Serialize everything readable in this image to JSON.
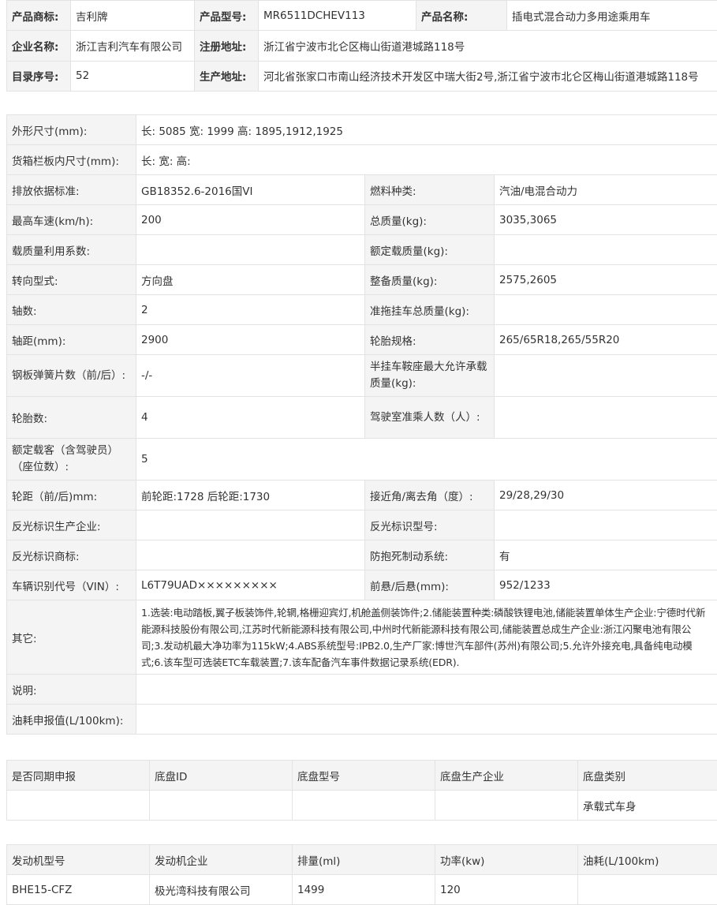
{
  "header": {
    "rows": [
      [
        {
          "label": "产品商标:",
          "value": "吉利牌"
        },
        {
          "label": "产品型号:",
          "value": "MR6511DCHEV113"
        },
        {
          "label": "产品名称:",
          "value": "插电式混合动力多用途乘用车"
        }
      ],
      [
        {
          "label": "企业名称:",
          "value": "浙江吉利汽车有限公司"
        },
        {
          "label": "注册地址:",
          "value": "浙江省宁波市北仑区梅山街道港城路118号"
        }
      ],
      [
        {
          "label": "目录序号:",
          "value": "52"
        },
        {
          "label": "生产地址:",
          "value": "河北省张家口市南山经济技术开发区中瑞大街2号,浙江省宁波市北仑区梅山街道港城路118号"
        }
      ]
    ]
  },
  "params": {
    "dimensions": {
      "label": "外形尺寸(mm):",
      "value": "长:  5085 宽:  1999 高:  1895,1912,1925"
    },
    "cargo_box": {
      "label": "货箱栏板内尺寸(mm):",
      "value": "长:   宽:   高:"
    },
    "pairs": [
      {
        "l1": "排放依据标准:",
        "v1": "GB18352.6-2016国VI",
        "l2": "燃料种类:",
        "v2": "汽油/电混合动力"
      },
      {
        "l1": "最高车速(km/h):",
        "v1": "200",
        "l2": "总质量(kg):",
        "v2": "3035,3065"
      },
      {
        "l1": "载质量利用系数:",
        "v1": "",
        "l2": "额定载质量(kg):",
        "v2": ""
      },
      {
        "l1": "转向型式:",
        "v1": "方向盘",
        "l2": "整备质量(kg):",
        "v2": "2575,2605"
      },
      {
        "l1": "轴数:",
        "v1": "2",
        "l2": "准拖挂车总质量(kg):",
        "v2": ""
      },
      {
        "l1": "轴距(mm):",
        "v1": "2900",
        "l2": "轮胎规格:",
        "v2": "265/65R18,265/55R20"
      },
      {
        "l1": "钢板弹簧片数（前/后）:",
        "v1": "-/-",
        "l2": "半挂车鞍座最大允许承载质量(kg):",
        "v2": ""
      },
      {
        "l1": "轮胎数:",
        "v1": "4",
        "l2": "驾驶室准乘人数（人）:",
        "v2": ""
      }
    ],
    "rated_passengers": {
      "label": "额定载客（含驾驶员）（座位数）:",
      "value": "5"
    },
    "pairs2": [
      {
        "l1": "轮距（前/后)mm:",
        "v1": "前轮距:1728 后轮距:1730",
        "l2": "接近角/离去角（度）:",
        "v2": "29/28,29/30"
      },
      {
        "l1": "反光标识生产企业:",
        "v1": "",
        "l2": "反光标识型号:",
        "v2": ""
      },
      {
        "l1": "反光标识商标:",
        "v1": "",
        "l2": "防抱死制动系统:",
        "v2": "有"
      },
      {
        "l1": "车辆识别代号（VIN）:",
        "v1": "L6T79UAD×××××××××",
        "l2": "前悬/后悬(mm):",
        "v2": "952/1233"
      }
    ],
    "other": {
      "label": "其它:",
      "value": "1.选装:电动踏板,翼子板装饰件,轮辋,格栅迎宾灯,机舱盖侧装饰件;2.储能装置种类:磷酸铁锂电池,储能装置单体生产企业:宁德时代新能源科技股份有限公司,江苏时代新能源科技有限公司,中州时代新能源科技有限公司,储能装置总成生产企业:浙江闪聚电池有限公司;3.发动机最大净功率为115kW;4.ABS系统型号:IPB2.0,生产厂家:博世汽车部件(苏州)有限公司;5.允许外接充电,具备纯电动模式;6.该车型可选装ETC车载装置;7.该车配备汽车事件数据记录系统(EDR)."
    },
    "note": {
      "label": "说明:",
      "value": ""
    },
    "fuel": {
      "label": "油耗申报值(L/100km):",
      "value": ""
    }
  },
  "chassis": {
    "headers": [
      "是否同期申报",
      "底盘ID",
      "底盘型号",
      "底盘生产企业",
      "底盘类别"
    ],
    "row": [
      "",
      "",
      "",
      "",
      "承载式车身"
    ]
  },
  "engine": {
    "headers": [
      "发动机型号",
      "发动机企业",
      "排量(ml)",
      "功率(kw)",
      "油耗(L/100km)"
    ],
    "row": [
      "BHE15-CFZ",
      "极光湾科技有限公司",
      "1499",
      "120",
      ""
    ]
  }
}
